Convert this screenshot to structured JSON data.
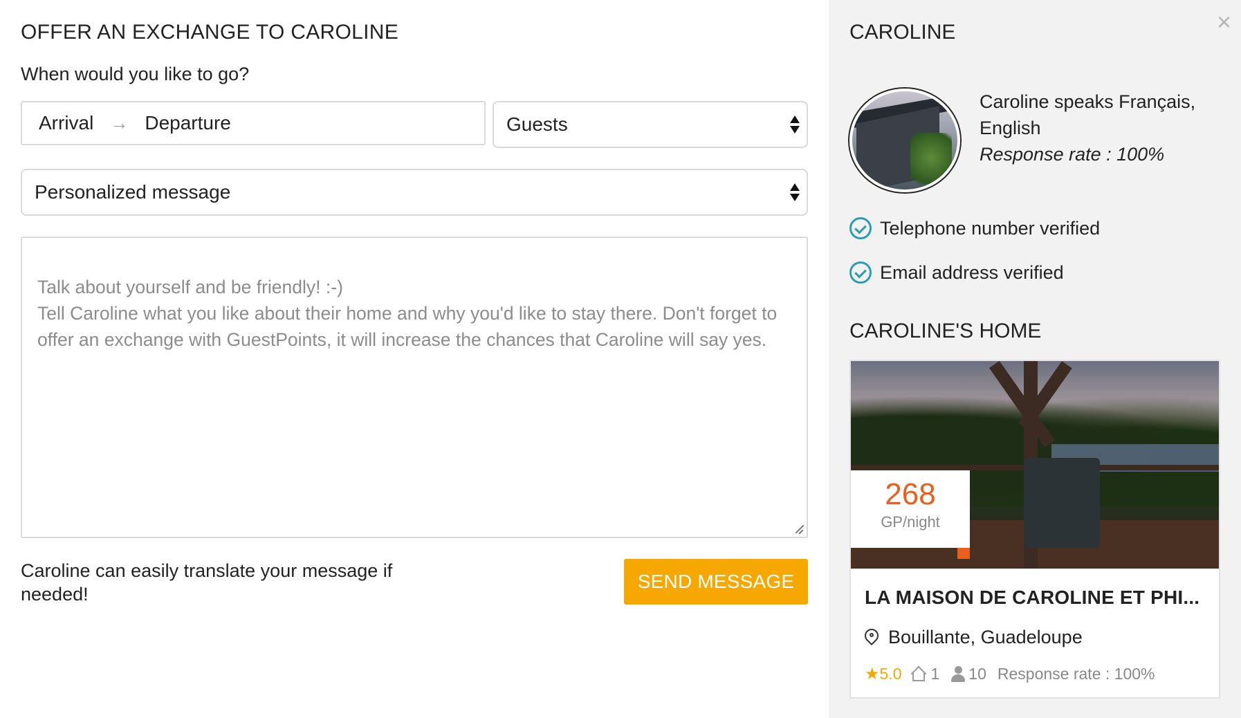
{
  "form": {
    "title": "OFFER AN EXCHANGE TO CAROLINE",
    "question": "When would you like to go?",
    "arrival_label": "Arrival",
    "arrow": "→",
    "departure_label": "Departure",
    "guests_label": "Guests",
    "message_type": "Personalized message",
    "message_placeholder": "Talk about yourself and be friendly! :-)\nTell Caroline what you like about their home and why you'd like to stay there. Don't forget to offer an exchange with GuestPoints, it will increase the chances that Caroline will say yes.",
    "translate_note": "Caroline can easily translate your message if needed!",
    "send_button": "SEND MESSAGE"
  },
  "host": {
    "name": "CAROLINE",
    "languages": "Caroline speaks Français, English",
    "response_rate": "Response rate : 100%",
    "verifications": [
      {
        "label": "Telephone number verified"
      },
      {
        "label": "Email address verified"
      }
    ]
  },
  "home": {
    "section_title": "CAROLINE'S HOME",
    "price": "268",
    "price_unit": "GP/night",
    "listing_title": "LA MAISON DE CAROLINE ET PHI...",
    "location": "Bouillante, Guadeloupe",
    "rating_star": "★",
    "rating": "5.0",
    "bedrooms": "1",
    "guests": "10",
    "response_rate": "Response rate : 100%"
  },
  "ui": {
    "close_symbol": "×",
    "accent_color": "#f7a800",
    "price_color": "#e8601c",
    "check_color": "#2a9db1"
  }
}
